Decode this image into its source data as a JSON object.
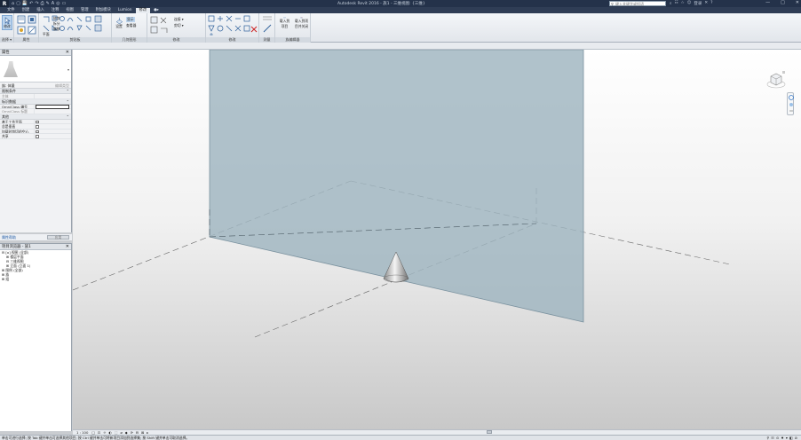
{
  "window": {
    "title": "Autodesk Revit 2016 -   族1 - 三维视图: {三维}",
    "app_logo": "R",
    "search_placeholder": "键入关键字或短语",
    "login_label": "登录",
    "controls": [
      "—",
      "□",
      "✕"
    ]
  },
  "quick_access": [
    "⌂",
    "▢",
    "💾",
    "↶",
    "↷",
    "⎙",
    "✎",
    "A",
    "◎",
    "▭"
  ],
  "tabs": [
    {
      "label": "文件",
      "active": false
    },
    {
      "label": "创建",
      "active": false
    },
    {
      "label": "插入",
      "active": false
    },
    {
      "label": "注释",
      "active": false
    },
    {
      "label": "视图",
      "active": false
    },
    {
      "label": "管理",
      "active": false
    },
    {
      "label": "附加模块",
      "active": false
    },
    {
      "label": "Lumion",
      "active": false
    },
    {
      "label": "修改",
      "active": true
    },
    {
      "label": "●▸",
      "active": false
    }
  ],
  "ribbon": {
    "groups": [
      {
        "label": "选择 ▾",
        "buttons": [
          "修改"
        ]
      },
      {
        "label": "属性",
        "buttons": []
      },
      {
        "label": "剪贴板",
        "buttons": [
          "粘贴",
          "剪切",
          "连接"
        ]
      },
      {
        "label": "几何图形",
        "buttons": [
          "剪切",
          "连接"
        ]
      },
      {
        "label": "修改",
        "buttons": []
      },
      {
        "label": "测量",
        "buttons": []
      },
      {
        "label": "创建",
        "buttons": []
      },
      {
        "label": "族编辑器",
        "buttons": [
          "载入到项目",
          "载入到项目并关闭"
        ]
      }
    ],
    "small_labels": [
      "修剪",
      "拆分",
      "偏移",
      "平面",
      "设置",
      "显示",
      "查看器",
      "连接 ▾",
      "剪切 ▾",
      "视图"
    ]
  },
  "properties": {
    "header": "属性",
    "type_selector": "族: 体量",
    "edit_type": "编辑类型",
    "sections": [
      {
        "name": "限制条件",
        "rows": [
          {
            "key": "主体",
            "value": "",
            "grey": true
          }
        ]
      },
      {
        "name": "标识数据",
        "rows": [
          {
            "key": "OmniClass 编号",
            "value": "",
            "input": true,
            "grey": false
          },
          {
            "key": "OmniClass 标题",
            "value": "",
            "grey": true
          }
        ]
      },
      {
        "name": "其他",
        "rows": [
          {
            "key": "基于工作平面",
            "checkbox": true
          },
          {
            "key": "总是垂直",
            "checkbox": true
          },
          {
            "key": "加载时剪切的空心",
            "checkbox": true
          },
          {
            "key": "共享",
            "checkbox": true
          }
        ]
      }
    ],
    "help_link": "属性帮助",
    "apply_label": "应用"
  },
  "browser": {
    "header": "项目浏览器 - 族1",
    "items": [
      {
        "label": "⊟ [o] 视图 (全部)",
        "level": 1
      },
      {
        "label": "⊞ 楼层平面",
        "level": 2
      },
      {
        "label": "⊟ 三维视图",
        "level": 2
      },
      {
        "label": "⊞ 立面 (立面 1)",
        "level": 2
      },
      {
        "label": "⊞ 图例 (全部)",
        "level": 1
      },
      {
        "label": "⊞ 族",
        "level": 1
      },
      {
        "label": "⊞ 组",
        "level": 1
      }
    ]
  },
  "viewbar": {
    "scale": "1 : 100",
    "icons": [
      "□",
      "⊡",
      "☼",
      "◐",
      "⬚",
      "⌀",
      "◆",
      "⟳",
      "⊟",
      "⊠",
      "▸"
    ]
  },
  "status": {
    "text": "单击可进行选择; 按 Tab 键并单击可选择其他项目; 按 Ctrl 键并单击可将新项目添加到选择集; 按 Shift 键并单击可取消选择。",
    "right_icons": [
      "⚲",
      "☷",
      "⊙",
      "♦",
      "▾",
      "◧",
      "⊘"
    ]
  },
  "colors": {
    "titlebar": "#24324a",
    "tabs_bg": "#2f3d55",
    "plane_fill": "#9fb4bf",
    "accent": "#1f5aa6"
  }
}
